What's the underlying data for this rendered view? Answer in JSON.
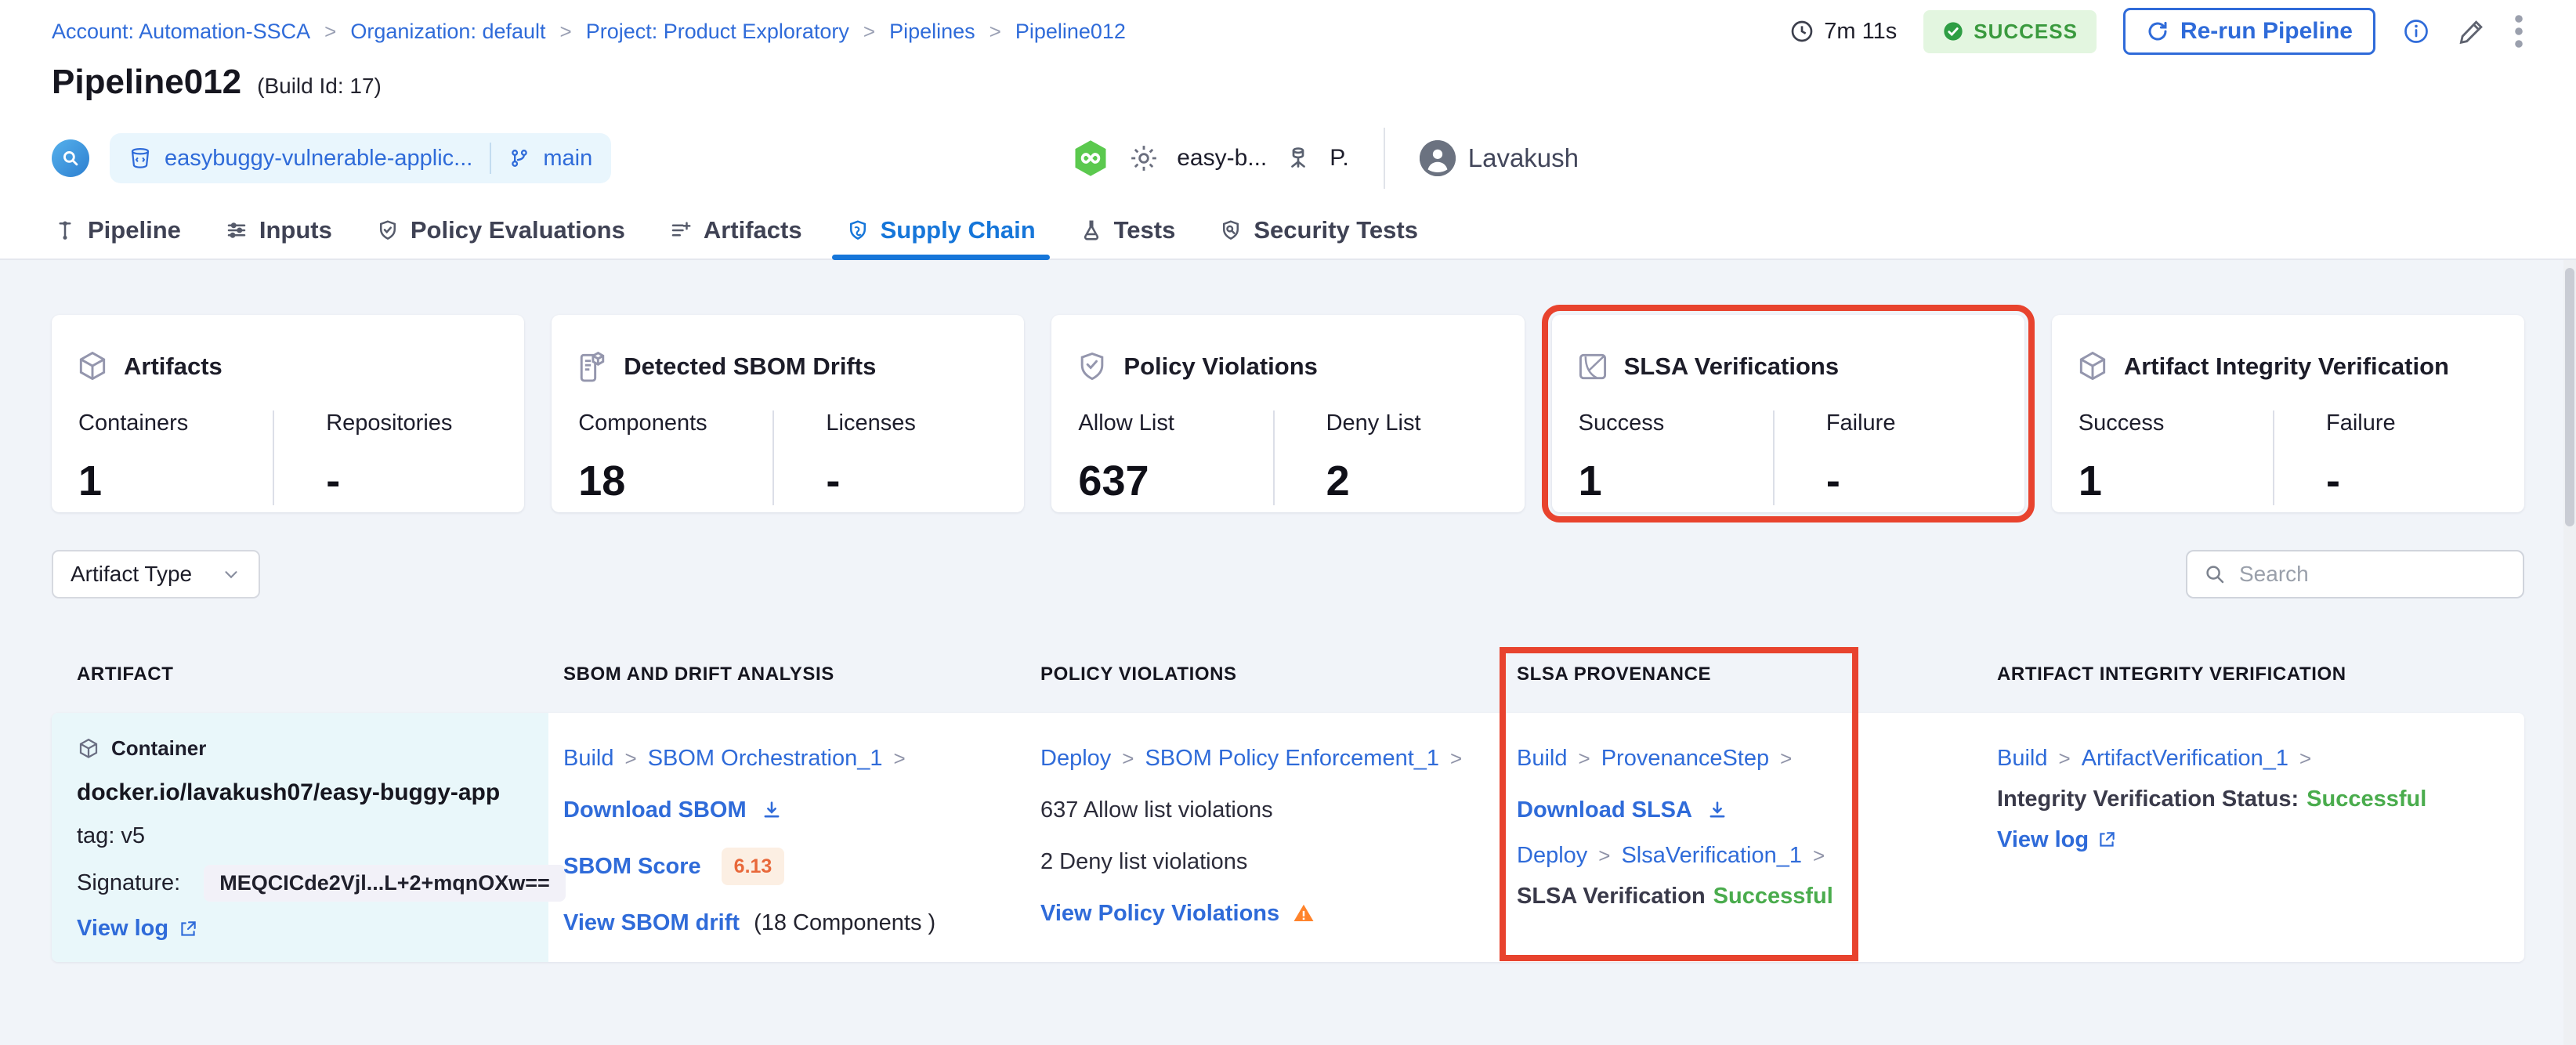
{
  "glyphs": {
    "chevron": ">"
  },
  "breadcrumb": {
    "items": [
      "Account: Automation-SSCA",
      "Organization: default",
      "Project: Product Exploratory",
      "Pipelines",
      "Pipeline012"
    ]
  },
  "header": {
    "duration": "7m 11s",
    "status": "SUCCESS",
    "rerun_label": "Re-run Pipeline",
    "title": "Pipeline012",
    "build_id": "(Build Id: 17)"
  },
  "meta": {
    "repo": "easybuggy-vulnerable-applic...",
    "branch": "main",
    "codebase": "easy-b...",
    "trigger_abbrev": "P.",
    "user": "Lavakush"
  },
  "tabs": {
    "items": [
      {
        "label": "Pipeline"
      },
      {
        "label": "Inputs"
      },
      {
        "label": "Policy Evaluations"
      },
      {
        "label": "Artifacts"
      },
      {
        "label": "Supply Chain"
      },
      {
        "label": "Tests"
      },
      {
        "label": "Security Tests"
      }
    ]
  },
  "summary_cards": [
    {
      "title": "Artifacts",
      "stats": [
        {
          "label": "Containers",
          "value": "1"
        },
        {
          "label": "Repositories",
          "value": "-"
        }
      ]
    },
    {
      "title": "Detected SBOM Drifts",
      "stats": [
        {
          "label": "Components",
          "value": "18"
        },
        {
          "label": "Licenses",
          "value": "-"
        }
      ]
    },
    {
      "title": "Policy Violations",
      "stats": [
        {
          "label": "Allow List",
          "value": "637"
        },
        {
          "label": "Deny List",
          "value": "2"
        }
      ]
    },
    {
      "title": "SLSA Verifications",
      "stats": [
        {
          "label": "Success",
          "value": "1"
        },
        {
          "label": "Failure",
          "value": "-"
        }
      ]
    },
    {
      "title": "Artifact Integrity Verification",
      "stats": [
        {
          "label": "Success",
          "value": "1"
        },
        {
          "label": "Failure",
          "value": "-"
        }
      ]
    }
  ],
  "filters": {
    "artifact_type_label": "Artifact Type",
    "search_placeholder": "Search"
  },
  "table": {
    "columns": [
      "ARTIFACT",
      "SBOM AND DRIFT ANALYSIS",
      "POLICY VIOLATIONS",
      "SLSA PROVENANCE",
      "ARTIFACT INTEGRITY VERIFICATION"
    ],
    "row": {
      "artifact": {
        "type": "Container",
        "image": "docker.io/lavakush07/easy-buggy-app",
        "tag": "tag: v5",
        "signature_label": "Signature:",
        "signature": "MEQCICde2Vjl...L+2+mqnOXw==",
        "view_log": "View log"
      },
      "sbom": {
        "stage": "Build",
        "step": "SBOM Orchestration_1",
        "download": "Download SBOM",
        "score_label": "SBOM Score",
        "score": "6.13",
        "drift_link": "View SBOM drift",
        "drift_suffix": "(18 Components )"
      },
      "policy": {
        "stage": "Deploy",
        "step": "SBOM Policy Enforcement_1",
        "allow": "637 Allow list violations",
        "deny": "2 Deny list violations",
        "view": "View Policy Violations"
      },
      "slsa": {
        "stage1": "Build",
        "step1": "ProvenanceStep",
        "download": "Download SLSA",
        "stage2": "Deploy",
        "step2": "SlsaVerification_1",
        "status_label": "SLSA Verification",
        "status": "Successful"
      },
      "integrity": {
        "stage": "Build",
        "step": "ArtifactVerification_1",
        "status_label": "Integrity Verification Status:",
        "status": "Successful",
        "view_log": "View log"
      }
    }
  }
}
